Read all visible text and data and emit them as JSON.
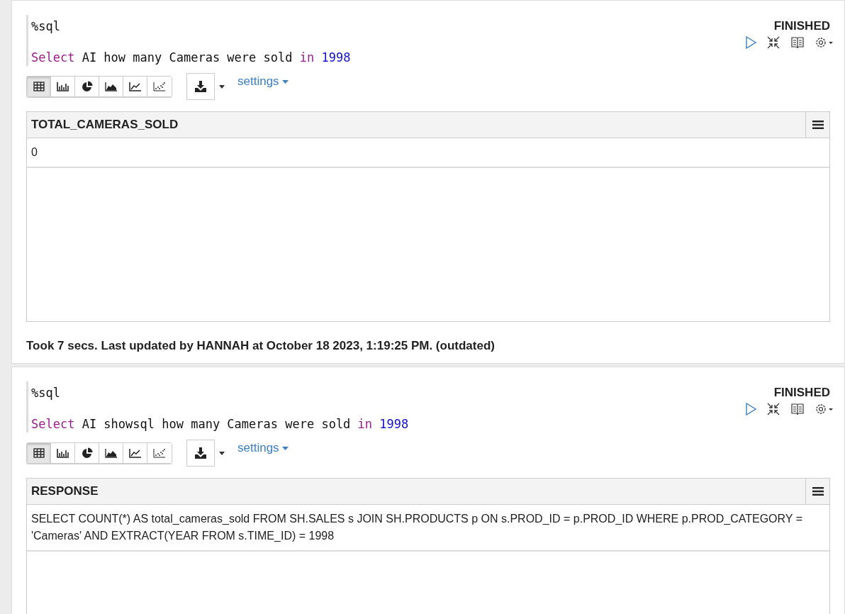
{
  "paragraphs": [
    {
      "interpreter": "%sql",
      "query": [
        {
          "text": "Select",
          "kind": "keyword"
        },
        {
          "text": " AI how many Cameras were sold ",
          "kind": "plain"
        },
        {
          "text": "in",
          "kind": "keyword"
        },
        {
          "text": " 1998",
          "kind": "number"
        }
      ],
      "status": "FINISHED",
      "view_modes": [
        {
          "kind": "table",
          "selected": true
        },
        {
          "kind": "bar",
          "selected": false
        },
        {
          "kind": "pie",
          "selected": false
        },
        {
          "kind": "area",
          "selected": false
        },
        {
          "kind": "line",
          "selected": false
        },
        {
          "kind": "scatter",
          "selected": false
        }
      ],
      "settings_label": "settings",
      "table": {
        "columns": [
          "TOTAL_CAMERAS_SOLD"
        ],
        "rows": [
          [
            "0"
          ]
        ]
      },
      "footer": "Took 7 secs. Last updated by HANNAH at October 18 2023, 1:19:25 PM. (outdated)"
    },
    {
      "interpreter": "%sql",
      "query": [
        {
          "text": "Select",
          "kind": "keyword"
        },
        {
          "text": " AI showsql how many Cameras were sold ",
          "kind": "plain"
        },
        {
          "text": "in",
          "kind": "keyword"
        },
        {
          "text": " 1998",
          "kind": "number"
        }
      ],
      "status": "FINISHED",
      "view_modes": [
        {
          "kind": "table",
          "selected": true
        },
        {
          "kind": "bar",
          "selected": false
        },
        {
          "kind": "pie",
          "selected": false
        },
        {
          "kind": "area",
          "selected": false
        },
        {
          "kind": "line",
          "selected": false
        },
        {
          "kind": "scatter",
          "selected": false
        }
      ],
      "settings_label": "settings",
      "table": {
        "columns": [
          "RESPONSE"
        ],
        "rows": [
          [
            "SELECT COUNT(*) AS total_cameras_sold FROM SH.SALES s JOIN SH.PRODUCTS p ON s.PROD_ID = p.PROD_ID WHERE p.PROD_CATEGORY = 'Cameras' AND EXTRACT(YEAR FROM s.TIME_ID) = 1998"
          ]
        ]
      }
    }
  ]
}
